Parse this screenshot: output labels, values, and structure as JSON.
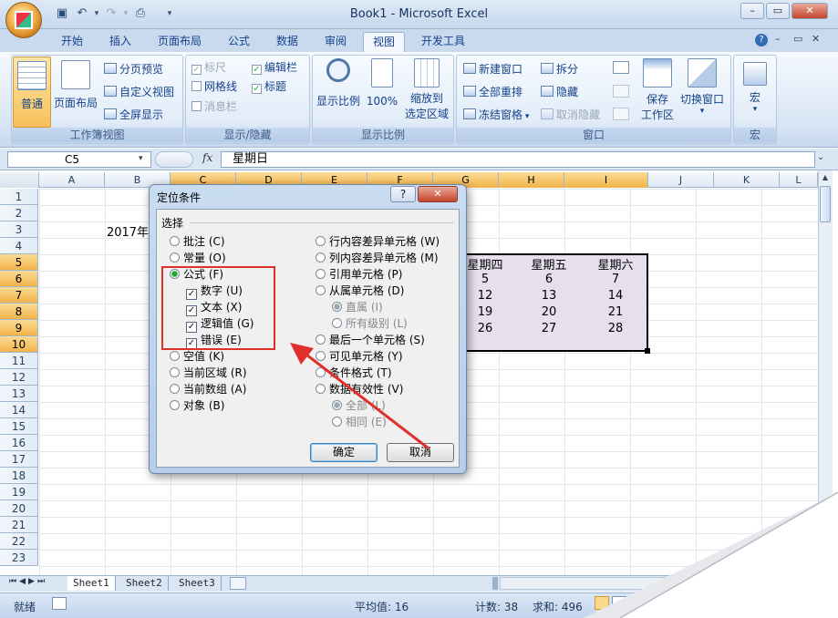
{
  "app": {
    "title": "Book1 - Microsoft Excel"
  },
  "tabs": [
    "开始",
    "插入",
    "页面布局",
    "公式",
    "数据",
    "审阅",
    "视图",
    "开发工具"
  ],
  "active_tab": "视图",
  "ribbon": {
    "workbook_views": {
      "label": "工作簿视图",
      "normal": "普通",
      "page_layout": "页面布局",
      "page_break": "分页预览",
      "custom_views": "自定义视图",
      "full_screen": "全屏显示"
    },
    "show_hide": {
      "label": "显示/隐藏",
      "ruler": "标尺",
      "gridlines": "网格线",
      "messages": "消息栏",
      "formula_bar": "编辑栏",
      "headings": "标题"
    },
    "zoom": {
      "label": "显示比例",
      "zoom": "显示比例",
      "hundred": "100%",
      "zoom_sel_1": "缩放到",
      "zoom_sel_2": "选定区域"
    },
    "window": {
      "label": "窗口",
      "new_window": "新建窗口",
      "arrange_all": "全部重排",
      "freeze": "冻结窗格",
      "split": "拆分",
      "hide": "隐藏",
      "unhide": "取消隐藏",
      "save_ws_1": "保存",
      "save_ws_2": "工作区",
      "switch": "切换窗口"
    },
    "macros": {
      "label": "宏",
      "macros": "宏"
    }
  },
  "formula_bar": {
    "name_box": "C5",
    "fx": "fx",
    "content": "星期日"
  },
  "columns": [
    "A",
    "B",
    "C",
    "D",
    "E",
    "F",
    "G",
    "H",
    "I",
    "J",
    "K",
    "L"
  ],
  "rows": [
    "1",
    "2",
    "3",
    "4",
    "5",
    "6",
    "7",
    "8",
    "9",
    "10",
    "11",
    "12",
    "13",
    "14",
    "15",
    "16",
    "17",
    "18",
    "19",
    "20",
    "21",
    "22",
    "23"
  ],
  "cells": {
    "b3": "2017年",
    "headers": [
      "星期四",
      "星期五",
      "星期六"
    ],
    "r6": [
      "5",
      "6",
      "7"
    ],
    "r7": [
      "12",
      "13",
      "14"
    ],
    "r8": [
      "19",
      "20",
      "21"
    ],
    "r9": [
      "26",
      "27",
      "28"
    ]
  },
  "dialog": {
    "title": "定位条件",
    "help": "?",
    "close": "✕",
    "section": "选择",
    "left": [
      {
        "label": "批注 (C)"
      },
      {
        "label": "常量 (O)"
      },
      {
        "label": "公式 (F)"
      },
      {
        "label": "数字 (U)"
      },
      {
        "label": "文本 (X)"
      },
      {
        "label": "逻辑值 (G)"
      },
      {
        "label": "错误 (E)"
      },
      {
        "label": "空值 (K)"
      },
      {
        "label": "当前区域 (R)"
      },
      {
        "label": "当前数组 (A)"
      },
      {
        "label": "对象 (B)"
      }
    ],
    "right": [
      {
        "label": "行内容差异单元格 (W)"
      },
      {
        "label": "列内容差异单元格 (M)"
      },
      {
        "label": "引用单元格 (P)"
      },
      {
        "label": "从属单元格 (D)"
      },
      {
        "label": "直属 (I)"
      },
      {
        "label": "所有级别 (L)"
      },
      {
        "label": "最后一个单元格 (S)"
      },
      {
        "label": "可见单元格 (Y)"
      },
      {
        "label": "条件格式 (T)"
      },
      {
        "label": "数据有效性 (V)"
      },
      {
        "label": "全部 (L)"
      },
      {
        "label": "相同 (E)"
      }
    ],
    "ok": "确定",
    "cancel": "取消"
  },
  "sheet_tabs": [
    "Sheet1",
    "Sheet2",
    "Sheet3"
  ],
  "status": {
    "ready": "就绪",
    "average": "平均值: 16",
    "count": "计数: 38",
    "sum": "求和: 496"
  },
  "colors": {
    "annotation": "#e0302b",
    "selected_header": "#f2b348"
  }
}
